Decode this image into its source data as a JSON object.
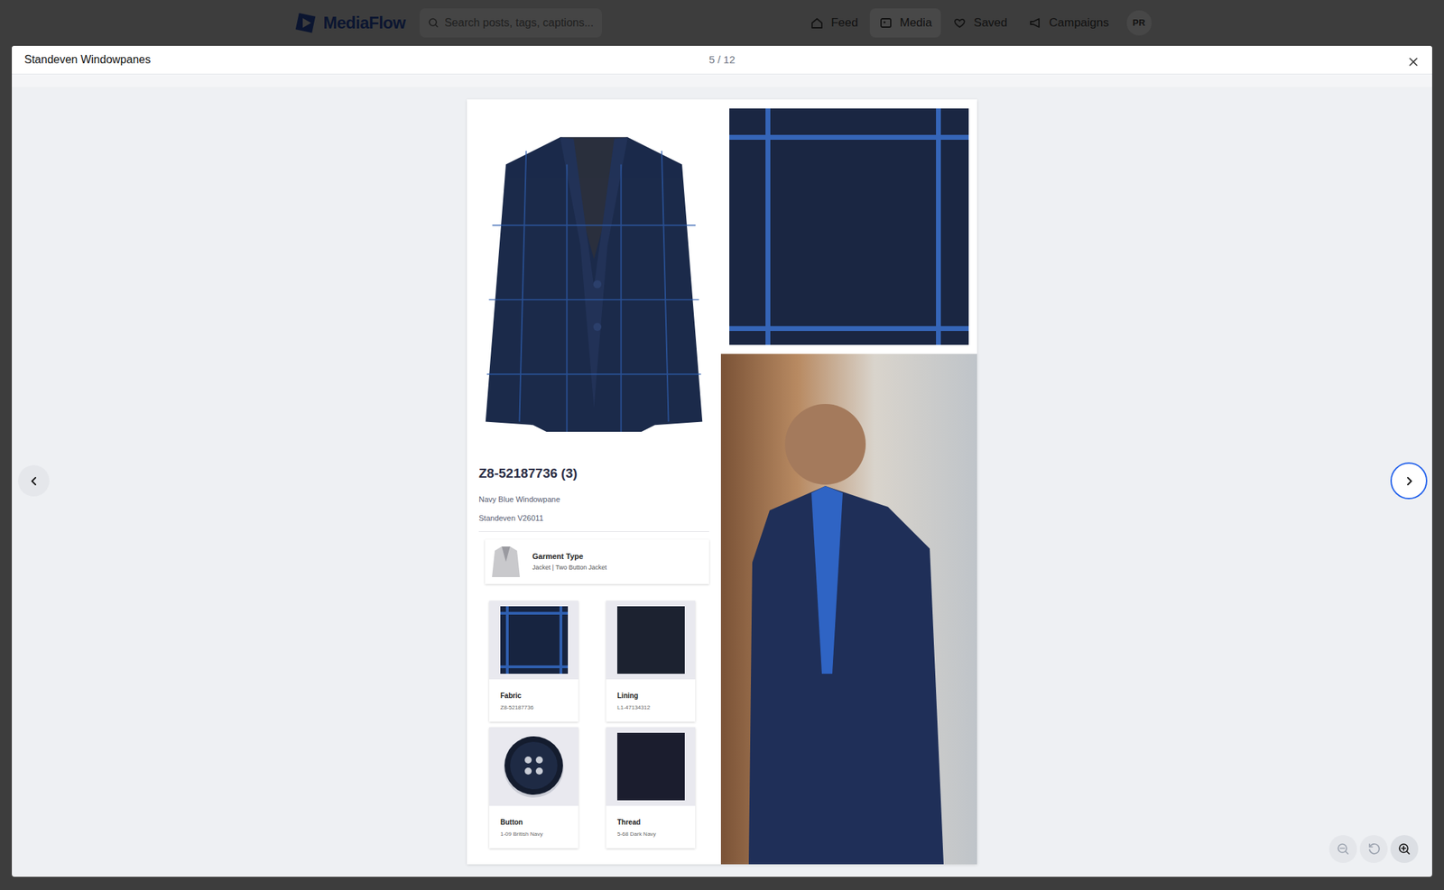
{
  "nav": {
    "logo": "MediaFlow",
    "search": {
      "placeholder": "Search posts, tags, captions..."
    },
    "items": [
      {
        "label": "Feed",
        "selected": false
      },
      {
        "label": "Media",
        "selected": true
      },
      {
        "label": "Saved",
        "selected": false
      },
      {
        "label": "Campaigns",
        "selected": false
      }
    ],
    "avatar": "PR"
  },
  "viewer": {
    "title": "Standeven Windowpanes",
    "counter": "5 / 12",
    "prev": {
      "focused": false
    },
    "next": {
      "focused": true
    },
    "zoom": [
      {
        "action": "zoom-out",
        "disabled": true
      },
      {
        "action": "reset",
        "disabled": true
      },
      {
        "action": "zoom-in",
        "disabled": false
      }
    ]
  },
  "sheet": {
    "code": "Z8-52187736 (3)",
    "name": "Navy Blue Windowpane",
    "collection": "Standeven V26011",
    "garment": {
      "label": "Garment Type",
      "value": "Jacket | Two Button Jacket"
    },
    "parts": [
      {
        "label": "Fabric",
        "value": "Z8-52187736",
        "kind": "fabric"
      },
      {
        "label": "Lining",
        "value": "L1-47134312",
        "kind": "lining"
      },
      {
        "label": "Button",
        "value": "1-09 British Navy",
        "kind": "button"
      },
      {
        "label": "Thread",
        "value": "5-68 Dark Navy",
        "kind": "thread"
      }
    ]
  }
}
